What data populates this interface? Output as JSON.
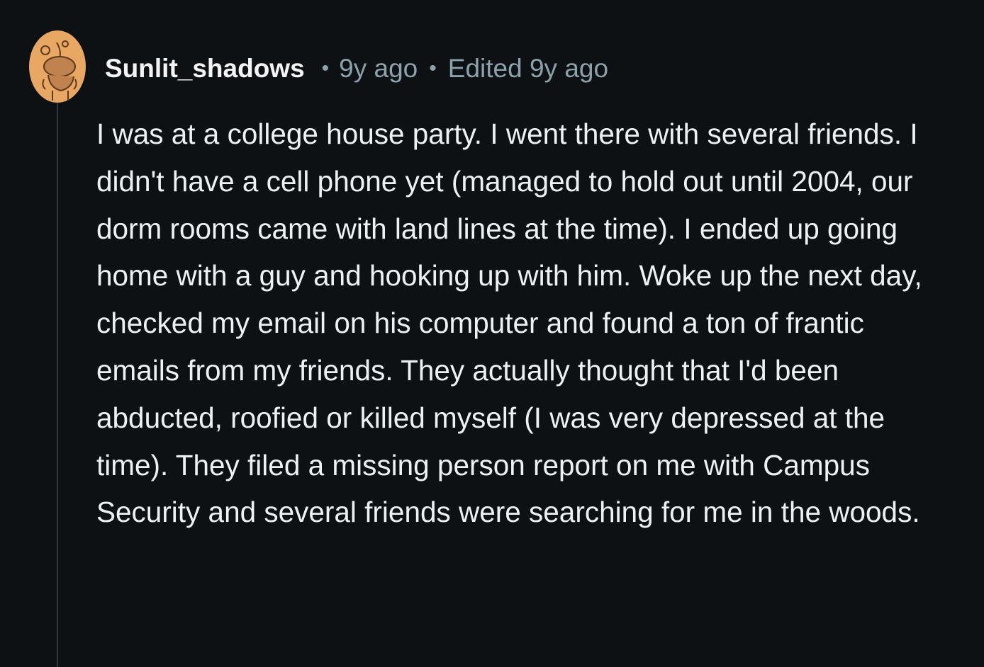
{
  "comment": {
    "author": "Sunlit_shadows",
    "separator": "•",
    "time_ago": "9y ago",
    "edited": "Edited 9y ago",
    "body": "I was at a college house party. I went there with several friends. I didn't have a cell phone yet (managed to hold out until 2004, our dorm rooms came with land lines at the time). I ended up going home with a guy and hooking up with him. Woke up the next day, checked my email on his computer and found a ton of frantic emails from my friends. They actually thought that I'd been abducted, roofied or killed myself (I was very depressed at the time). They filed a missing person report on me with Campus Security and several friends were searching for me in the woods."
  },
  "colors": {
    "background": "#0e1113",
    "text_primary": "#eef1f3",
    "text_secondary": "#8ba2ad",
    "thread_line": "#33383c",
    "avatar_fill": "#e8a864"
  },
  "icons": {
    "avatar": "snoo-avatar-icon"
  }
}
